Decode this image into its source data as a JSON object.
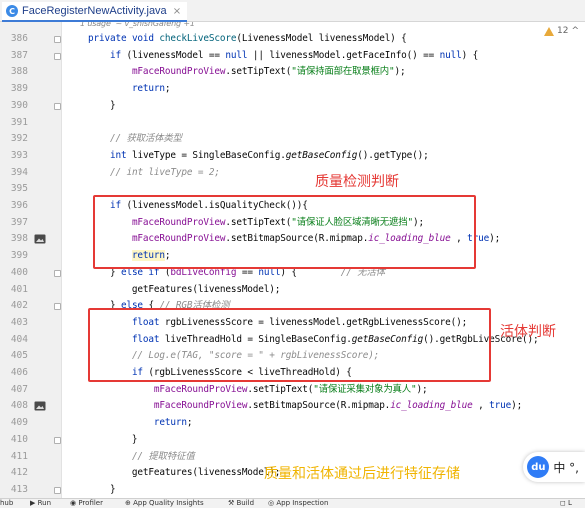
{
  "tab": {
    "icon_letter": "C",
    "title": "FaceRegisterNewActivity.java",
    "close": "×"
  },
  "warning": {
    "count": "12",
    "more": "^"
  },
  "usage_hint": "1 usage  ~ v_shishGafeng +1",
  "gutter": {
    "line_numbers": [
      "386",
      "387",
      "388",
      "389",
      "390",
      "391",
      "392",
      "393",
      "394",
      "395",
      "396",
      "397",
      "398",
      "399",
      "400",
      "401",
      "402",
      "403",
      "404",
      "405",
      "406",
      "407",
      "408",
      "409",
      "410",
      "411",
      "412",
      "413"
    ],
    "image_icons": [
      "image-icon",
      "image-icon"
    ]
  },
  "code_lines": [
    [
      [
        "    ",
        ""
      ],
      [
        "private void ",
        "kw"
      ],
      [
        "checkLiveScore",
        "fn"
      ],
      [
        "(LivenessModel livenessModel) {",
        ""
      ]
    ],
    [
      [
        "        ",
        ""
      ],
      [
        "if ",
        "kw"
      ],
      [
        "(livenessModel == ",
        ""
      ],
      [
        "null",
        "kw"
      ],
      [
        " || livenessModel.getFaceInfo() == ",
        ""
      ],
      [
        "null",
        "kw"
      ],
      [
        ") {",
        ""
      ]
    ],
    [
      [
        "            ",
        ""
      ],
      [
        "mFaceRoundProView",
        "fld"
      ],
      [
        ".setTipText(",
        ""
      ],
      [
        "\"请保持面部在取景框内\"",
        "str"
      ],
      [
        ");",
        ""
      ]
    ],
    [
      [
        "            ",
        ""
      ],
      [
        "return",
        "kw"
      ],
      [
        ";",
        ""
      ]
    ],
    [
      [
        "        }",
        ""
      ]
    ],
    [
      [
        "",
        ""
      ]
    ],
    [
      [
        "        ",
        ""
      ],
      [
        "// 获取活体类型",
        "com"
      ]
    ],
    [
      [
        "        ",
        ""
      ],
      [
        "int ",
        "kw"
      ],
      [
        "liveType = SingleBaseConfig.",
        ""
      ],
      [
        "getBaseConfig",
        "stat"
      ],
      [
        "().getType();",
        ""
      ]
    ],
    [
      [
        "        ",
        ""
      ],
      [
        "// int liveType = 2;",
        "com"
      ]
    ],
    [
      [
        "",
        ""
      ]
    ],
    [
      [
        "        ",
        ""
      ],
      [
        "if ",
        "kw"
      ],
      [
        "(livenessModel.isQualityCheck()){",
        ""
      ]
    ],
    [
      [
        "            ",
        ""
      ],
      [
        "mFaceRoundProView",
        "fld"
      ],
      [
        ".setTipText(",
        ""
      ],
      [
        "\"请保证人脸区域清晰无遮挡\"",
        "str"
      ],
      [
        ");",
        ""
      ]
    ],
    [
      [
        "            ",
        ""
      ],
      [
        "mFaceRoundProView",
        "fld"
      ],
      [
        ".setBitmapSource(R.mipmap.",
        ""
      ],
      [
        "ic_loading_blue",
        "res"
      ],
      [
        " , ",
        ""
      ],
      [
        "true",
        "kw"
      ],
      [
        ");",
        ""
      ]
    ],
    [
      [
        "            ",
        ""
      ],
      [
        "return",
        "kw"
      ],
      [
        ";",
        ""
      ]
    ],
    [
      [
        "        } ",
        ""
      ],
      [
        "else if ",
        "kw"
      ],
      [
        "(",
        ""
      ],
      [
        "bdLiveConfig",
        "fld"
      ],
      [
        " == ",
        ""
      ],
      [
        "null",
        "kw"
      ],
      [
        ") {        ",
        ""
      ],
      [
        "// 无活体",
        "com"
      ]
    ],
    [
      [
        "            getFeatures(livenessModel);",
        ""
      ]
    ],
    [
      [
        "        } ",
        ""
      ],
      [
        "else ",
        "kw"
      ],
      [
        "{ ",
        ""
      ],
      [
        "// RGB活体检测",
        "com"
      ]
    ],
    [
      [
        "            ",
        ""
      ],
      [
        "float ",
        "kw"
      ],
      [
        "rgbLivenessScore = livenessModel.getRgbLivenessScore();",
        ""
      ]
    ],
    [
      [
        "            ",
        ""
      ],
      [
        "float ",
        "kw"
      ],
      [
        "liveThreadHold = SingleBaseConfig.",
        ""
      ],
      [
        "getBaseConfig",
        "stat"
      ],
      [
        "().getRgbLiveScore();",
        ""
      ]
    ],
    [
      [
        "            ",
        ""
      ],
      [
        "// Log.e(TAG, \"score = \" + rgbLivenessScore);",
        "com"
      ]
    ],
    [
      [
        "            ",
        ""
      ],
      [
        "if ",
        "kw"
      ],
      [
        "(rgbLivenessScore < liveThreadHold) {",
        ""
      ]
    ],
    [
      [
        "                ",
        ""
      ],
      [
        "mFaceRoundProView",
        "fld"
      ],
      [
        ".setTipText(",
        ""
      ],
      [
        "\"请保证采集对象为真人\"",
        "str"
      ],
      [
        ");",
        ""
      ]
    ],
    [
      [
        "                ",
        ""
      ],
      [
        "mFaceRoundProView",
        "fld"
      ],
      [
        ".setBitmapSource(R.mipmap.",
        ""
      ],
      [
        "ic_loading_blue",
        "res"
      ],
      [
        " , ",
        ""
      ],
      [
        "true",
        "kw"
      ],
      [
        ");",
        ""
      ]
    ],
    [
      [
        "                ",
        ""
      ],
      [
        "return",
        "kw"
      ],
      [
        ";",
        ""
      ]
    ],
    [
      [
        "            }",
        ""
      ]
    ],
    [
      [
        "            ",
        ""
      ],
      [
        "// 提取特征值",
        "com"
      ]
    ],
    [
      [
        "            getFeatures(livenessModel);",
        ""
      ]
    ],
    [
      [
        "        }",
        ""
      ]
    ]
  ],
  "annotations": {
    "quality_label": "质量检测判断",
    "liveness_label": "活体判断",
    "storage_label": "质量和活体通过后进行特征存储",
    "box_color": "#e53935",
    "quality_color": "#e53935",
    "liveness_color": "#e53935",
    "storage_color": "#f0b400"
  },
  "badge": {
    "logo": "du",
    "text": "中 °,"
  },
  "bottom_toolbar": [
    "hub",
    "▶ Run",
    "◉ Profiler",
    "⊕ App Quality Insights",
    "⚒ Build",
    "◎ App Inspection",
    "◻ L"
  ]
}
